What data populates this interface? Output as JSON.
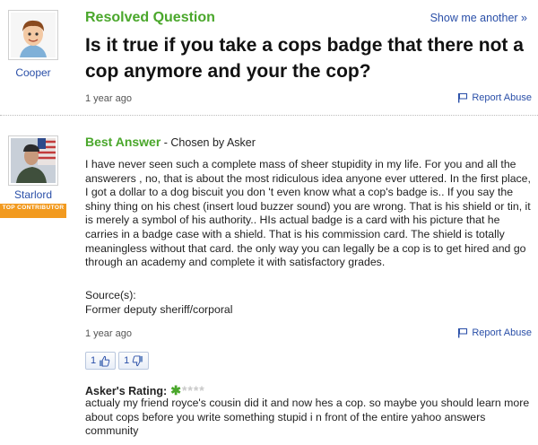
{
  "question": {
    "status": "Resolved Question",
    "show_another": "Show me another »",
    "title": "Is it true if you take a cops badge that there not a cop anymore and your the cop?",
    "asker": "Cooper",
    "time": "1 year ago",
    "report_abuse": "Report Abuse"
  },
  "answer": {
    "label": "Best Answer",
    "chosen_by": " - Chosen by Asker",
    "answerer": "Starlord",
    "badge": "TOP CONTRIBUTOR",
    "body": "I have never seen such a complete mass of sheer stupidity in my life. For you and all the answerers , no, that is about the most ridiculous idea anyone ever uttered. In the first place, I got a dollar to a dog biscuit you don 't even know what a cop's badge is.. If you say the shiny thing on his chest (insert loud buzzer sound) you are wrong. That is his shield or tin, it is merely a symbol of his authority.. HIs actual badge is a card with his picture that he carries in a badge case with a shield. That is his commission card. The shield is totally meaningless without that card. the only way you can legally be a cop is to get hired and go through an academy and complete it with satisfactory grades.",
    "sources_label": "Source(s):",
    "source": "Former deputy sheriff/corporal",
    "time": "1 year ago",
    "report_abuse": "Report Abuse",
    "thumbs_up": "1",
    "thumbs_down": "1",
    "rating_label": "Asker's Rating:",
    "rating": 1,
    "rating_max": 5,
    "rating_comment": "actualy my friend royce's cousin did it and now hes a cop. so maybe you should learn more about cops before you write something stupid i n front of the entire yahoo answers community"
  },
  "colors": {
    "accent_green": "#4aa72b",
    "link_blue": "#2a4fa8",
    "badge_orange": "#f29a1f"
  }
}
